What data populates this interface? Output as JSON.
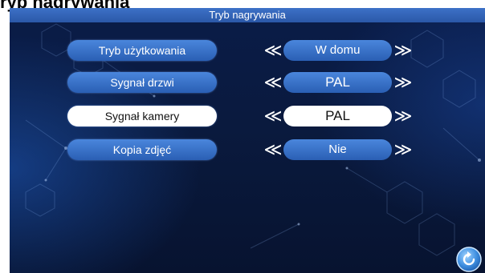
{
  "page_heading": "ryb nagrywania",
  "title_bar": "Tryb nagrywania",
  "rows": [
    {
      "label": "Tryb użytkowania",
      "value": "W domu"
    },
    {
      "label": "Sygnał drzwi",
      "value": "PAL"
    },
    {
      "label": "Sygnał kamery",
      "value": "PAL"
    },
    {
      "label": "Kopia zdjęć",
      "value": "Nie"
    }
  ],
  "arrows": {
    "left": "≪",
    "right": "≫"
  },
  "icons": {
    "back": "back-arrow-icon",
    "prev": "double-chevron-left-icon",
    "next": "double-chevron-right-icon"
  },
  "colors": {
    "accent": "#3a6fc4",
    "background": "#0a1a3e",
    "selected": "#ffffff"
  }
}
